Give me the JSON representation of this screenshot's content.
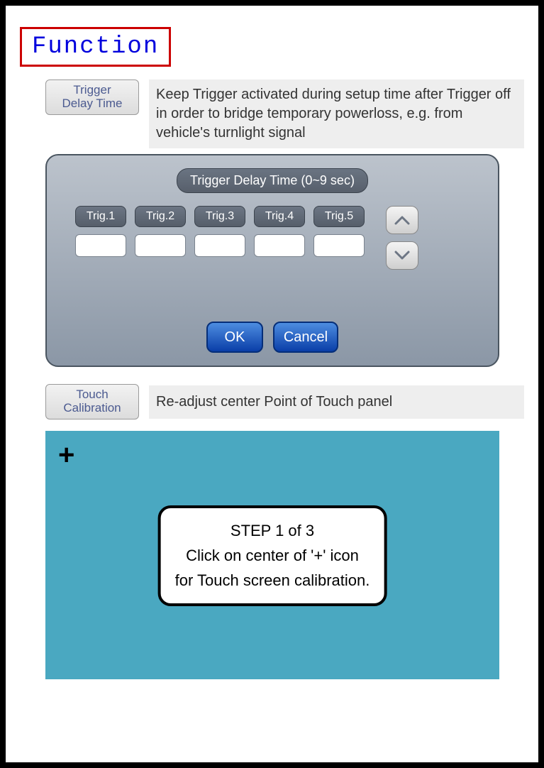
{
  "title": "Function",
  "trigger_delay": {
    "label_line1": "Trigger",
    "label_line2": "Delay Time",
    "description": "Keep Trigger activated during setup time after Trigger off in order to bridge temporary powerloss, e.g. from vehicle's turnlight signal",
    "dialog_title": "Trigger Delay Time (0~9 sec)",
    "trigs": [
      "Trig.1",
      "Trig.2",
      "Trig.3",
      "Trig.4",
      "Trig.5"
    ],
    "ok_label": "OK",
    "cancel_label": "Cancel"
  },
  "touch_calibration": {
    "label_line1": "Touch",
    "label_line2": "Calibration",
    "description": "Re-adjust center Point of Touch panel",
    "plus_symbol": "+",
    "step_title": "STEP 1 of 3",
    "step_line2": "Click on center of '+' icon",
    "step_line3": "for Touch screen calibration."
  }
}
